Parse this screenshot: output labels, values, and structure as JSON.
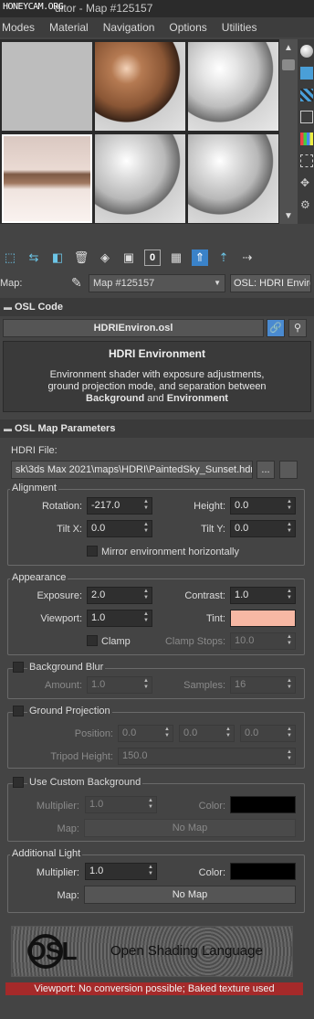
{
  "window": {
    "title": "ditor - Map #125157",
    "watermark": "HONEYCAM.ORG"
  },
  "menu": [
    "Modes",
    "Material",
    "Navigation",
    "Options",
    "Utilities"
  ],
  "slots": [
    {
      "type": "flat",
      "color": "#bdbdbd",
      "selected": false
    },
    {
      "type": "sphere",
      "color": "#a6704d",
      "selected": false
    },
    {
      "type": "sphere",
      "color": "#d8d8d8",
      "selected": false
    },
    {
      "type": "image",
      "color": "#e8d0c8",
      "selected": true
    },
    {
      "type": "sphere",
      "color": "#cfcfcf",
      "selected": false
    },
    {
      "type": "sphere",
      "color": "#d2d2d2",
      "selected": false
    }
  ],
  "maprow": {
    "label": "Map:",
    "map_name": "Map #125157",
    "type_button": "OSL: HDRI Envirom"
  },
  "osl_code": {
    "header": "OSL Code",
    "file_button": "HDRIEnviron.osl",
    "title": "HDRI Environment",
    "desc1": "Environment shader with exposure adjustments,",
    "desc2": "ground projection mode, and separation between",
    "desc3_b1": "Background",
    "desc3_and": "and",
    "desc3_b2": "Environment"
  },
  "params": {
    "header": "OSL Map Parameters",
    "hdri_label": "HDRI File:",
    "hdri_path": "sk\\3ds Max 2021\\maps\\HDRI\\PaintedSky_Sunset.hdr",
    "browse": "...",
    "alignment": {
      "title": "Alignment",
      "rotation_label": "Rotation:",
      "rotation": "-217.0",
      "height_label": "Height:",
      "height": "0.0",
      "tiltx_label": "Tilt X:",
      "tiltx": "0.0",
      "tilty_label": "Tilt Y:",
      "tilty": "0.0",
      "mirror_label": "Mirror environment horizontally"
    },
    "appearance": {
      "title": "Appearance",
      "exposure_label": "Exposure:",
      "exposure": "2.0",
      "contrast_label": "Contrast:",
      "contrast": "1.0",
      "viewport_label": "Viewport:",
      "viewport": "1.0",
      "tint_label": "Tint:",
      "tint_color": "#f7b8a4",
      "clamp_label": "Clamp",
      "clamp_stops_label": "Clamp Stops:",
      "clamp_stops": "10.0"
    },
    "bg_blur": {
      "title": "Background Blur",
      "amount_label": "Amount:",
      "amount": "1.0",
      "samples_label": "Samples:",
      "samples": "16"
    },
    "ground": {
      "title": "Ground Projection",
      "position_label": "Position:",
      "px": "0.0",
      "py": "0.0",
      "pz": "0.0",
      "tripod_label": "Tripod Height:",
      "tripod": "150.0"
    },
    "custom_bg": {
      "title": "Use Custom Background",
      "multiplier_label": "Multiplier:",
      "multiplier": "1.0",
      "color_label": "Color:",
      "color": "#000000",
      "map_label": "Map:",
      "map_value": "No Map"
    },
    "add_light": {
      "title": "Additional Light",
      "multiplier_label": "Multiplier:",
      "multiplier": "1.0",
      "color_label": "Color:",
      "color": "#000000",
      "map_label": "Map:",
      "map_value": "No Map"
    }
  },
  "logo": {
    "letters": "OSL",
    "text": "Open Shading Language"
  },
  "status": {
    "text": "Viewport: No conversion possible; Baked texture used",
    "color": "#a52a2a"
  }
}
